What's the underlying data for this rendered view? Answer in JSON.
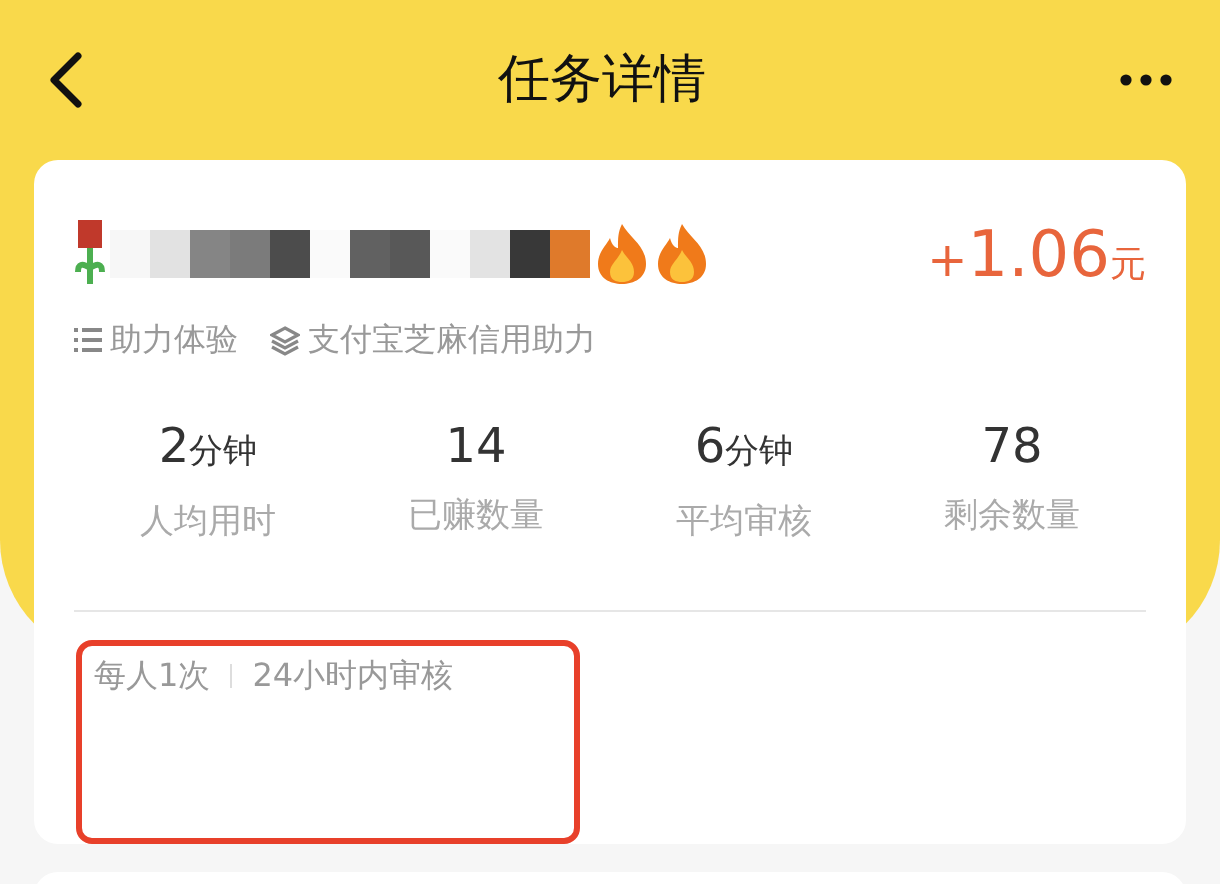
{
  "header": {
    "title": "任务详情"
  },
  "task": {
    "reward": {
      "sign": "+",
      "amount": "1.06",
      "unit": "元"
    },
    "tags": [
      {
        "kind": "list",
        "label": "助力体验"
      },
      {
        "kind": "layers",
        "label": "支付宝芝麻信用助力"
      }
    ],
    "stats": [
      {
        "value": "2",
        "unit": "分钟",
        "label": "人均用时"
      },
      {
        "value": "14",
        "label": "已赚数量"
      },
      {
        "value": "6",
        "unit": "分钟",
        "label": "平均审核"
      },
      {
        "value": "78",
        "label": "剩余数量"
      }
    ],
    "rules": [
      "每人1次",
      "24小时内审核"
    ]
  }
}
